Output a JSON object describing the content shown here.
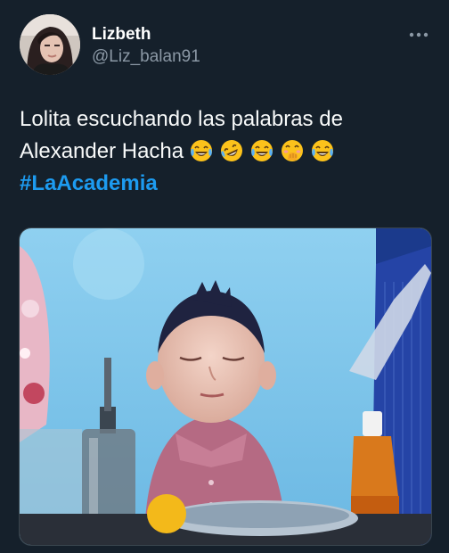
{
  "author": {
    "name": "Lizbeth",
    "handle": "@Liz_balan91"
  },
  "menu": {
    "more_icon": "more-horizontal-icon"
  },
  "tweet": {
    "line1": "Lolita escuchando las palabras de",
    "line2": "Alexander Hacha",
    "emojis": [
      "face-with-tears-of-joy",
      "rolling-on-floor-laughing",
      "face-with-tears-of-joy",
      "face-with-hand-over-mouth",
      "face-with-tears-of-joy"
    ],
    "hashtag": "#LaAcademia"
  },
  "colors": {
    "background": "#15202b",
    "text": "#f7f9f9",
    "secondary_text": "#8b98a5",
    "link": "#1d9bf0"
  }
}
